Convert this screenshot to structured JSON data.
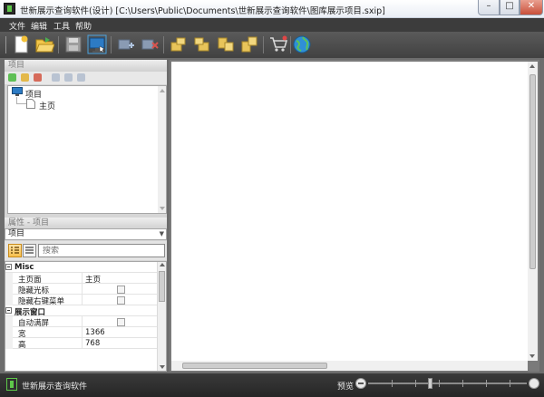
{
  "window": {
    "title": "世新展示查询软件(设计) [C:\\Users\\Public\\Documents\\世新展示查询软件\\图库展示项目.sxip]",
    "min_label": "–",
    "max_label": "□",
    "close_label": "✕"
  },
  "menu": {
    "items": [
      {
        "label": "文件"
      },
      {
        "label": "编辑"
      },
      {
        "label": "工具"
      },
      {
        "label": "帮助"
      }
    ]
  },
  "toolbar": {
    "icons": [
      "new-page-icon",
      "open-folder-icon",
      "save-icon",
      "preview-monitor-icon",
      "add-element-icon",
      "remove-element-icon",
      "align-left-icon",
      "align-right-icon",
      "align-top-icon",
      "align-bottom-icon",
      "shop-cart-icon",
      "publish-globe-icon"
    ]
  },
  "project_panel": {
    "header": "项目",
    "tree": {
      "root_label": "项目",
      "children": [
        {
          "label": "主页"
        }
      ]
    }
  },
  "property_panel": {
    "header": "属性 - 项目",
    "selected_object": "项目",
    "search_placeholder": "搜索",
    "rows": [
      {
        "type": "category",
        "label": "Misc"
      },
      {
        "type": "prop",
        "key": "主页面",
        "value": "主页"
      },
      {
        "type": "prop",
        "key": "隐藏光标",
        "value": "",
        "checkbox": true
      },
      {
        "type": "prop",
        "key": "隐藏右键菜单",
        "value": "",
        "checkbox": true
      },
      {
        "type": "category",
        "label": "展示窗口"
      },
      {
        "type": "prop",
        "key": "自动满屏",
        "value": "",
        "checkbox": true
      },
      {
        "type": "prop",
        "key": "宽",
        "value": "1366"
      },
      {
        "type": "prop",
        "key": "高",
        "value": "768"
      }
    ]
  },
  "statusbar": {
    "app_name": "世新展示查询软件",
    "preview_label": "预览"
  },
  "colors": {
    "menubar_bg": "#3c3c3c",
    "toolbar_bg": "#414141",
    "statusbar_bg": "#262626",
    "accent_green": "#5ec84a"
  }
}
